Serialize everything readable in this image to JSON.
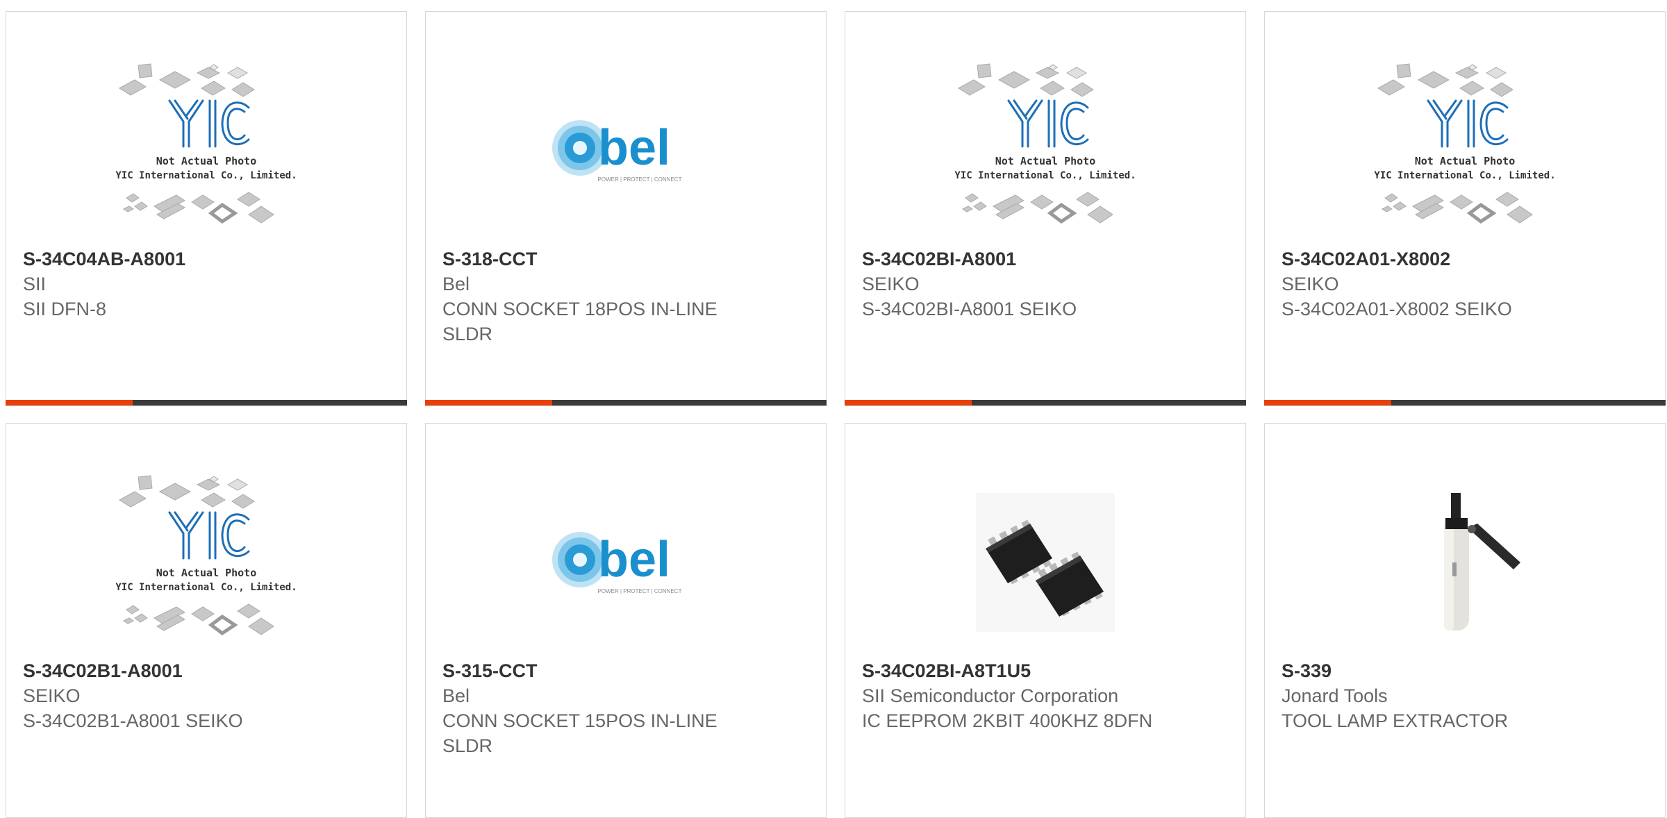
{
  "colors": {
    "accent": "#e8400c",
    "bar": "#3a3a3a",
    "yic_blue": "#1d6fb8",
    "bel_blue": "#1a8fce",
    "part_text": "#333333",
    "meta_text": "#666666"
  },
  "placeholder": {
    "brand": "YIC",
    "line1": "Not Actual Photo",
    "line2": "YIC International Co., Limited."
  },
  "bel_logo": {
    "word": "bel",
    "tagline": "POWER | PROTECT | CONNECT"
  },
  "products": [
    {
      "part": "S-34C04AB-A8001",
      "manufacturer": "SII",
      "description": "SII DFN-8",
      "image": "yic-placeholder-image"
    },
    {
      "part": "S-318-CCT",
      "manufacturer": "Bel",
      "description": "CONN SOCKET 18POS IN-LINE SLDR",
      "image": "bel-logo-image"
    },
    {
      "part": "S-34C02BI-A8001",
      "manufacturer": "SEIKO",
      "description": "S-34C02BI-A8001 SEIKO",
      "image": "yic-placeholder-image"
    },
    {
      "part": "S-34C02A01-X8002",
      "manufacturer": "SEIKO",
      "description": "S-34C02A01-X8002 SEIKO",
      "image": "yic-placeholder-image"
    },
    {
      "part": "S-34C02B1-A8001",
      "manufacturer": "SEIKO",
      "description": "S-34C02B1-A8001 SEIKO",
      "image": "yic-placeholder-image"
    },
    {
      "part": "S-315-CCT",
      "manufacturer": "Bel",
      "description": "CONN SOCKET 15POS IN-LINE SLDR",
      "image": "bel-logo-image"
    },
    {
      "part": "S-34C02BI-A8T1U5",
      "manufacturer": "SII Semiconductor Corporation",
      "description": "IC EEPROM 2KBIT 400KHZ 8DFN",
      "image": "soic-chip-photo"
    },
    {
      "part": "S-339",
      "manufacturer": "Jonard Tools",
      "description": "TOOL LAMP EXTRACTOR",
      "image": "lamp-extractor-tool-photo"
    }
  ]
}
